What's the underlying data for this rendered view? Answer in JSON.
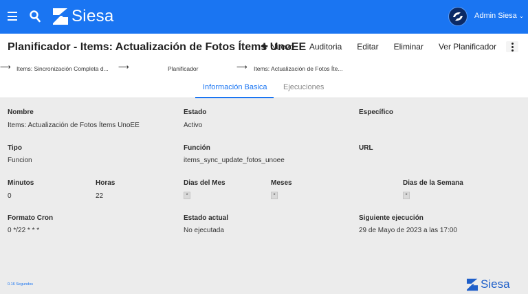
{
  "header": {
    "logo_text": "Siesa",
    "user_name": "Admin Siesa",
    "user_chevron": "⌄",
    "icons": {
      "menu": "menu-icon",
      "search": "search-icon",
      "logo": "siesa-logo-icon",
      "avatar": "avatar-icon"
    },
    "accent_color": "#1a75f2"
  },
  "titlebar": {
    "title": "Planificador - Items: Actualización de Fotos Ítems UnoEE",
    "actions": {
      "new": "Nuevo",
      "audit": "Auditoria",
      "edit": "Editar",
      "delete": "Eliminar",
      "view_scheduler": "Ver Planificador"
    }
  },
  "breadcrumb": {
    "items": [
      "Items: Sincronización Completa d...",
      "Planificador",
      "Items: Actualización de Fotos Íte..."
    ]
  },
  "tabs": {
    "basic": "Información Basica",
    "executions": "Ejecuciones"
  },
  "fields": {
    "nombre": {
      "label": "Nombre",
      "value": "Items: Actualización de Fotos Ítems UnoEE"
    },
    "estado": {
      "label": "Estado",
      "value": "Activo"
    },
    "especifico": {
      "label": "Específico",
      "value": ""
    },
    "tipo": {
      "label": "Tipo",
      "value": "Funcion"
    },
    "funcion": {
      "label": "Función",
      "value": "items_sync_update_fotos_unoee"
    },
    "url": {
      "label": "URL",
      "value": ""
    },
    "minutos": {
      "label": "Minutos",
      "value": "0"
    },
    "horas": {
      "label": "Horas",
      "value": "22"
    },
    "dias_mes": {
      "label": "Dias del Mes",
      "value": "*"
    },
    "meses": {
      "label": "Meses",
      "value": "*"
    },
    "dias_semana": {
      "label": "Dias de la Semana",
      "value": "*"
    },
    "formato_cron": {
      "label": "Formato Cron",
      "value": "0 */22 * * *"
    },
    "estado_actual": {
      "label": "Estado actual",
      "value": "No ejecutada"
    },
    "siguiente": {
      "label": "Siguiente ejecución",
      "value": "29 de Mayo de 2023 a las 17:00"
    }
  },
  "footer": {
    "note": "0.16 Segundos",
    "logo_text": "Siesa"
  }
}
